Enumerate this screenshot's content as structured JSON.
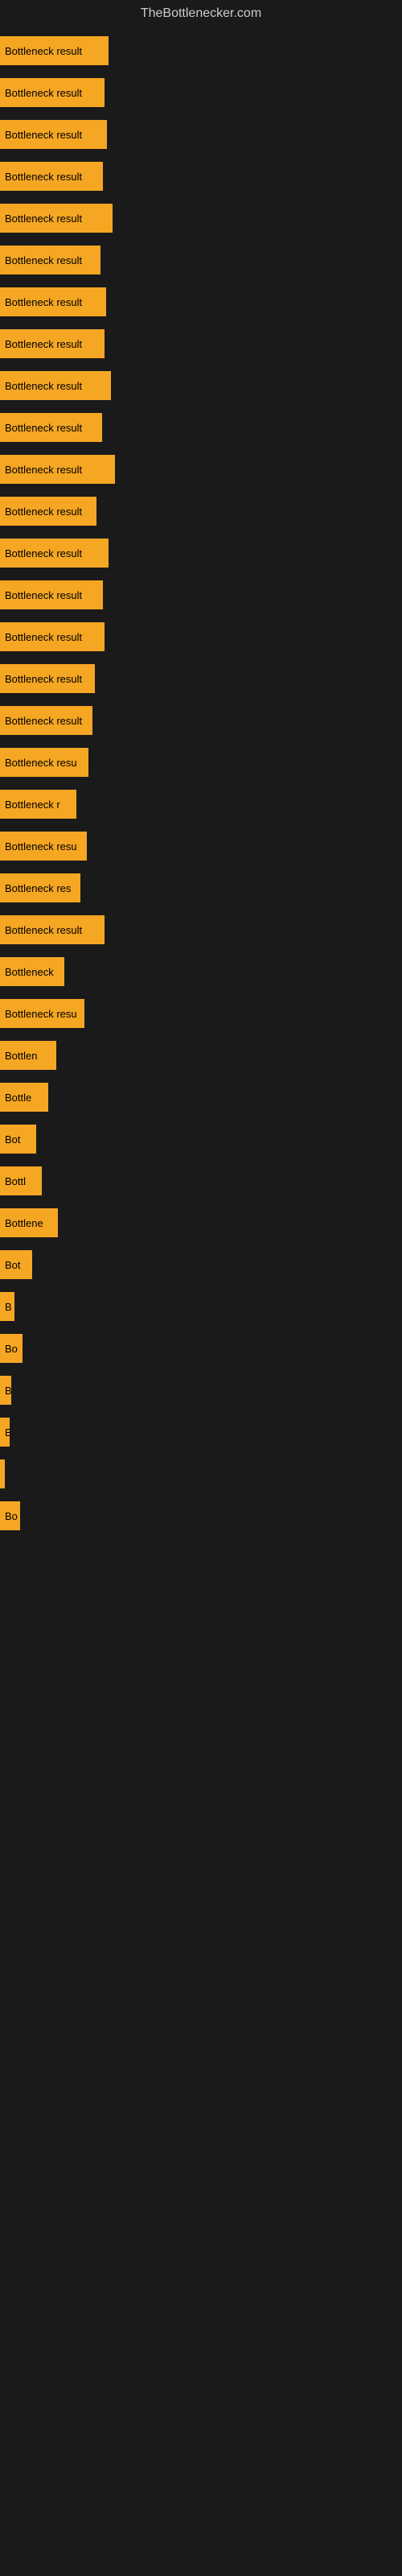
{
  "site": {
    "title": "TheBottlenecker.com"
  },
  "bars": [
    {
      "label": "Bottleneck result",
      "width": 135,
      "visible_label": "Bottleneck result"
    },
    {
      "label": "Bottleneck result",
      "width": 130,
      "visible_label": "Bottleneck result"
    },
    {
      "label": "Bottleneck result",
      "width": 133,
      "visible_label": "Bottleneck result"
    },
    {
      "label": "Bottleneck result",
      "width": 128,
      "visible_label": "Bottleneck result"
    },
    {
      "label": "Bottleneck result",
      "width": 140,
      "visible_label": "Bottleneck result"
    },
    {
      "label": "Bottleneck result",
      "width": 125,
      "visible_label": "Bottleneck result"
    },
    {
      "label": "Bottleneck result",
      "width": 132,
      "visible_label": "Bottleneck result"
    },
    {
      "label": "Bottleneck result",
      "width": 130,
      "visible_label": "Bottleneck result"
    },
    {
      "label": "Bottleneck result",
      "width": 138,
      "visible_label": "Bottleneck result"
    },
    {
      "label": "Bottleneck result",
      "width": 127,
      "visible_label": "Bottleneck result"
    },
    {
      "label": "Bottleneck result",
      "width": 143,
      "visible_label": "Bottleneck result"
    },
    {
      "label": "Bottleneck result",
      "width": 120,
      "visible_label": "Bottleneck result"
    },
    {
      "label": "Bottleneck result",
      "width": 135,
      "visible_label": "Bottleneck result"
    },
    {
      "label": "Bottleneck result",
      "width": 128,
      "visible_label": "Bottleneck result"
    },
    {
      "label": "Bottleneck result",
      "width": 130,
      "visible_label": "Bottleneck result"
    },
    {
      "label": "Bottleneck result",
      "width": 118,
      "visible_label": "Bottleneck result"
    },
    {
      "label": "Bottleneck result",
      "width": 115,
      "visible_label": "Bottleneck result"
    },
    {
      "label": "Bottleneck resu",
      "width": 110,
      "visible_label": "Bottleneck resu"
    },
    {
      "label": "Bottleneck r",
      "width": 95,
      "visible_label": "Bottleneck r"
    },
    {
      "label": "Bottleneck resu",
      "width": 108,
      "visible_label": "Bottleneck resu"
    },
    {
      "label": "Bottleneck res",
      "width": 100,
      "visible_label": "Bottleneck res"
    },
    {
      "label": "Bottleneck result",
      "width": 130,
      "visible_label": "Bottleneck result"
    },
    {
      "label": "Bottleneck",
      "width": 80,
      "visible_label": "Bottleneck"
    },
    {
      "label": "Bottleneck resu",
      "width": 105,
      "visible_label": "Bottleneck resu"
    },
    {
      "label": "Bottlen",
      "width": 70,
      "visible_label": "Bottlen"
    },
    {
      "label": "Bottle",
      "width": 60,
      "visible_label": "Bottle"
    },
    {
      "label": "Bot",
      "width": 45,
      "visible_label": "Bot"
    },
    {
      "label": "Bottl",
      "width": 52,
      "visible_label": "Bottl"
    },
    {
      "label": "Bottlene",
      "width": 72,
      "visible_label": "Bottlene"
    },
    {
      "label": "Bot",
      "width": 40,
      "visible_label": "Bot"
    },
    {
      "label": "B",
      "width": 18,
      "visible_label": "B"
    },
    {
      "label": "Bo",
      "width": 28,
      "visible_label": "Bo"
    },
    {
      "label": "B",
      "width": 14,
      "visible_label": "B"
    },
    {
      "label": "B",
      "width": 12,
      "visible_label": "B"
    },
    {
      "label": "",
      "width": 6,
      "visible_label": ""
    },
    {
      "label": "Bo",
      "width": 25,
      "visible_label": "Bo"
    }
  ]
}
